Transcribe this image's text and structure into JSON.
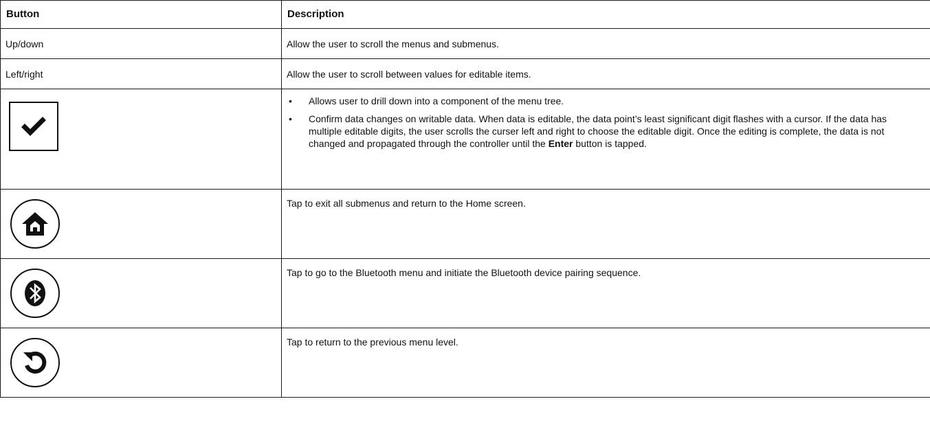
{
  "table": {
    "headers": {
      "button": "Button",
      "description": "Description"
    },
    "rows": [
      {
        "button_label": "Up/down",
        "description": "Allow the user to scroll the menus and submenus."
      },
      {
        "button_label": "Left/right",
        "description": "Allow the user to scroll between values for editable items."
      },
      {
        "button_icon": "checkmark-icon",
        "bullets": [
          "Allows user to drill down into a component of the menu tree.",
          "Confirm data changes on writable data. When data is editable, the data point’s least significant digit flashes with a cursor. If the data has multiple editable digits, the user scrolls the curser left and right to choose the editable digit. Once the editing is complete, the data is not changed and propagated through the controller until the "
        ],
        "bullet_bold": "Enter",
        "bullet_tail": " button is tapped."
      },
      {
        "button_icon": "home-icon",
        "description": "Tap to exit all submenus and return to the Home screen."
      },
      {
        "button_icon": "bluetooth-icon",
        "description": "Tap to go to the Bluetooth menu and initiate the Bluetooth device pairing sequence."
      },
      {
        "button_icon": "back-icon",
        "description": "Tap to return to the previous menu level."
      }
    ]
  }
}
